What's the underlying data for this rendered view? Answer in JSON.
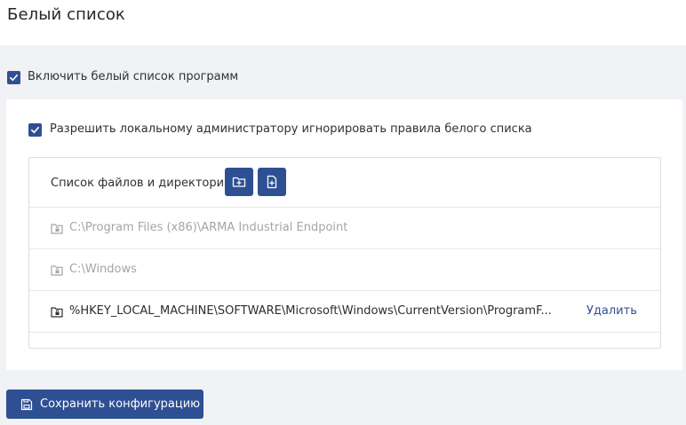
{
  "header": {
    "title": "Белый список"
  },
  "enable_whitelist": {
    "label": "Включить белый список программ",
    "checked": true
  },
  "allow_admin": {
    "label": "Разрешить локальному администратору игнорировать правила белого списка",
    "checked": true
  },
  "list": {
    "title": "Список файлов и директорий",
    "buttons": {
      "add_folder_icon": "folder-plus-icon",
      "add_file_icon": "file-plus-icon"
    },
    "rows": [
      {
        "path": "C:\\Program Files (x86)\\ARMA Industrial Endpoint",
        "icon": "folder-lock-icon",
        "deletable": false
      },
      {
        "path": "C:\\Windows",
        "icon": "folder-lock-icon",
        "deletable": false
      },
      {
        "path": "%HKEY_LOCAL_MACHINE\\SOFTWARE\\Microsoft\\Windows\\CurrentVersion\\ProgramF...",
        "icon": "folder-lock-icon",
        "deletable": true,
        "delete_label": "Удалить"
      }
    ]
  },
  "footer": {
    "save_label": "Сохранить конфигурацию"
  },
  "colors": {
    "accent": "#2f4f93",
    "background": "#f1f2f6",
    "disabled_text": "#a3a5ab"
  }
}
